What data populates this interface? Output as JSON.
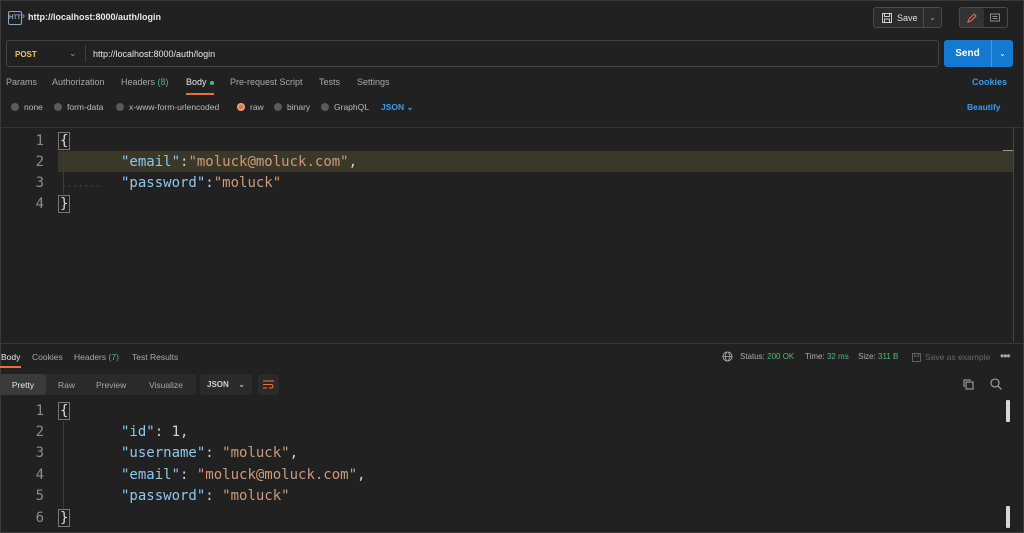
{
  "window": {
    "request_title": "http://localhost:8000/auth/login",
    "http_icon_label": "HTTP",
    "save_label": "Save"
  },
  "request": {
    "method": "POST",
    "url": "http://localhost:8000/auth/login",
    "send_label": "Send"
  },
  "request_tabs": [
    {
      "label": "Params"
    },
    {
      "label": "Authorization"
    },
    {
      "label": "Headers",
      "count": "(8)"
    },
    {
      "label": "Body",
      "active": true
    },
    {
      "label": "Pre-request Script"
    },
    {
      "label": "Tests"
    },
    {
      "label": "Settings"
    }
  ],
  "cookies_label": "Cookies",
  "body_types": [
    "none",
    "form-data",
    "x-www-form-urlencoded",
    "raw",
    "binary",
    "GraphQL"
  ],
  "body_format": "JSON",
  "beautify_label": "Beautify",
  "request_body": {
    "line_numbers": [
      "1",
      "2",
      "3",
      "4"
    ],
    "open_brace": "{",
    "close_brace": "}",
    "email_key": "\"email\"",
    "email_value": "\"moluck@moluck.com\"",
    "password_key": "\"password\"",
    "password_value": "\"moluck\""
  },
  "response_tabs": [
    {
      "label": "Body",
      "active": true
    },
    {
      "label": "Cookies"
    },
    {
      "label": "Headers",
      "count": "(7)"
    },
    {
      "label": "Test Results"
    }
  ],
  "response_status": {
    "status_label": "Status:",
    "status_value": "200 OK",
    "time_label": "Time:",
    "time_value": "32 ms",
    "size_label": "Size:",
    "size_value": "311 B",
    "save_example_label": "Save as example"
  },
  "response_views": [
    "Pretty",
    "Raw",
    "Preview",
    "Visualize"
  ],
  "response_format": "JSON",
  "response_body": {
    "line_numbers": [
      "1",
      "2",
      "3",
      "4",
      "5",
      "6"
    ],
    "open_brace": "{",
    "close_brace": "}",
    "id_key": "\"id\"",
    "id_value": "1",
    "username_key": "\"username\"",
    "username_value": "\"moluck\"",
    "email_key": "\"email\"",
    "email_value": "\"moluck@moluck.com\"",
    "password_key": "\"password\"",
    "password_value": "\"moluck\""
  },
  "colors": {
    "accent_orange": "#f26b3a",
    "send_blue": "#1479d1",
    "status_green": "#4dbb7b",
    "method_yellow": "#f3c35a"
  }
}
